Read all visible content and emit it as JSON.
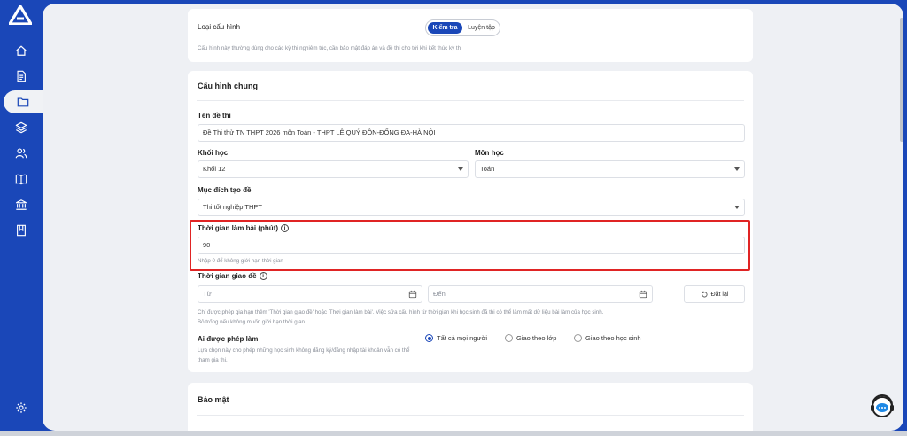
{
  "sidebar": {
    "items": [
      {
        "icon": "home-icon"
      },
      {
        "icon": "document-icon"
      },
      {
        "icon": "folder-icon",
        "active": true
      },
      {
        "icon": "layers-icon"
      },
      {
        "icon": "users-icon"
      },
      {
        "icon": "book-icon"
      },
      {
        "icon": "institution-icon"
      },
      {
        "icon": "bookmark-icon"
      }
    ],
    "settings_icon": "gear-icon"
  },
  "config_type": {
    "label": "Loại cấu hình",
    "options": [
      "Kiểm tra",
      "Luyện tập"
    ],
    "selected": "Kiểm tra",
    "help": "Cấu hình này thường dùng cho các kỳ thi nghiêm túc, cần bảo mật đáp án và đề thi cho tới khi kết thúc kỳ thi"
  },
  "general": {
    "title": "Cấu hình chung",
    "exam_name": {
      "label": "Tên đề thi",
      "value": "Đề Thi thử TN THPT 2026 môn Toán - THPT LÊ QUÝ ĐÔN-ĐỐNG ĐA-HÀ NỘI"
    },
    "grade": {
      "label": "Khối học",
      "value": "Khối 12"
    },
    "subject": {
      "label": "Môn học",
      "value": "Toán"
    },
    "purpose": {
      "label": "Mục đích tạo đề",
      "value": "Thi tốt nghiệp THPT"
    },
    "duration": {
      "label": "Thời gian làm bài (phút)",
      "value": "90",
      "help": "Nhập 0 để không giới hạn thời gian"
    },
    "assign_time": {
      "label": "Thời gian giao đề",
      "from_placeholder": "Từ",
      "to_placeholder": "Đến",
      "reset_label": "Đặt lại",
      "help_line1": "Chỉ được phép gia hạn thêm 'Thời gian giao đề' hoặc 'Thời gian làm bài'. Việc sửa cấu hình từ thời gian khi học sinh đã thi có thể làm mất dữ liệu bài làm của học sinh.",
      "help_line2": "Bỏ trống nếu không muốn giới hạn thời gian."
    },
    "access": {
      "label": "Ai được phép làm",
      "help_line1": "Lựa chọn này cho phép những học sinh không đăng ký/đăng nhập tài khoản vẫn có thể",
      "help_line2": "tham gia thi.",
      "options": [
        "Tất cả mọi người",
        "Giao theo lớp",
        "Giao theo học sinh"
      ],
      "selected": "Tất cả mọi người"
    }
  },
  "security": {
    "title": "Bảo mật"
  },
  "colors": {
    "primary": "#1a47b8",
    "highlight": "#e02424"
  }
}
